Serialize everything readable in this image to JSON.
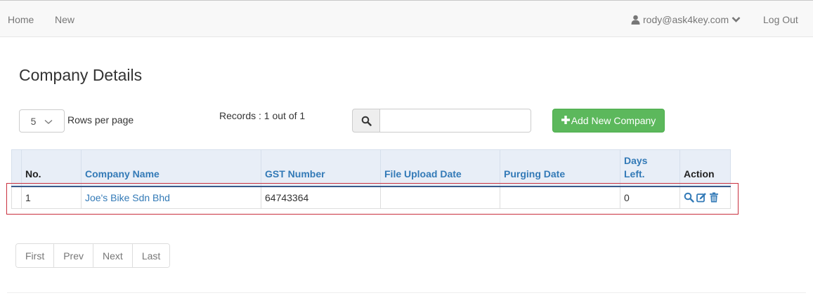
{
  "navbar": {
    "home": "Home",
    "new": "New",
    "user_email": "rody@ask4key.com",
    "logout": "Log Out"
  },
  "page": {
    "title": "Company Details"
  },
  "controls": {
    "rows_per_page_value": "5",
    "rows_per_page_label": "Rows per page",
    "records_text": "Records : 1 out of 1",
    "search_placeholder": "",
    "add_button": "Add New Company"
  },
  "table": {
    "headers": {
      "no": "No.",
      "company_name": "Company Name",
      "gst_number": "GST Number",
      "file_upload_date": "File Upload Date",
      "purging_date": "Purging Date",
      "days_left_1": "Days",
      "days_left_2": "Left.",
      "action": "Action"
    },
    "rows": [
      {
        "no": "1",
        "company_name": "Joe's Bike Sdn Bhd",
        "gst_number": "64743364",
        "file_upload_date": "",
        "purging_date": "",
        "days_left": "0"
      }
    ]
  },
  "pagination": {
    "first": "First",
    "prev": "Prev",
    "next": "Next",
    "last": "Last"
  },
  "colors": {
    "link": "#337ab7",
    "success": "#5cb85c",
    "highlight": "#c9303e"
  }
}
